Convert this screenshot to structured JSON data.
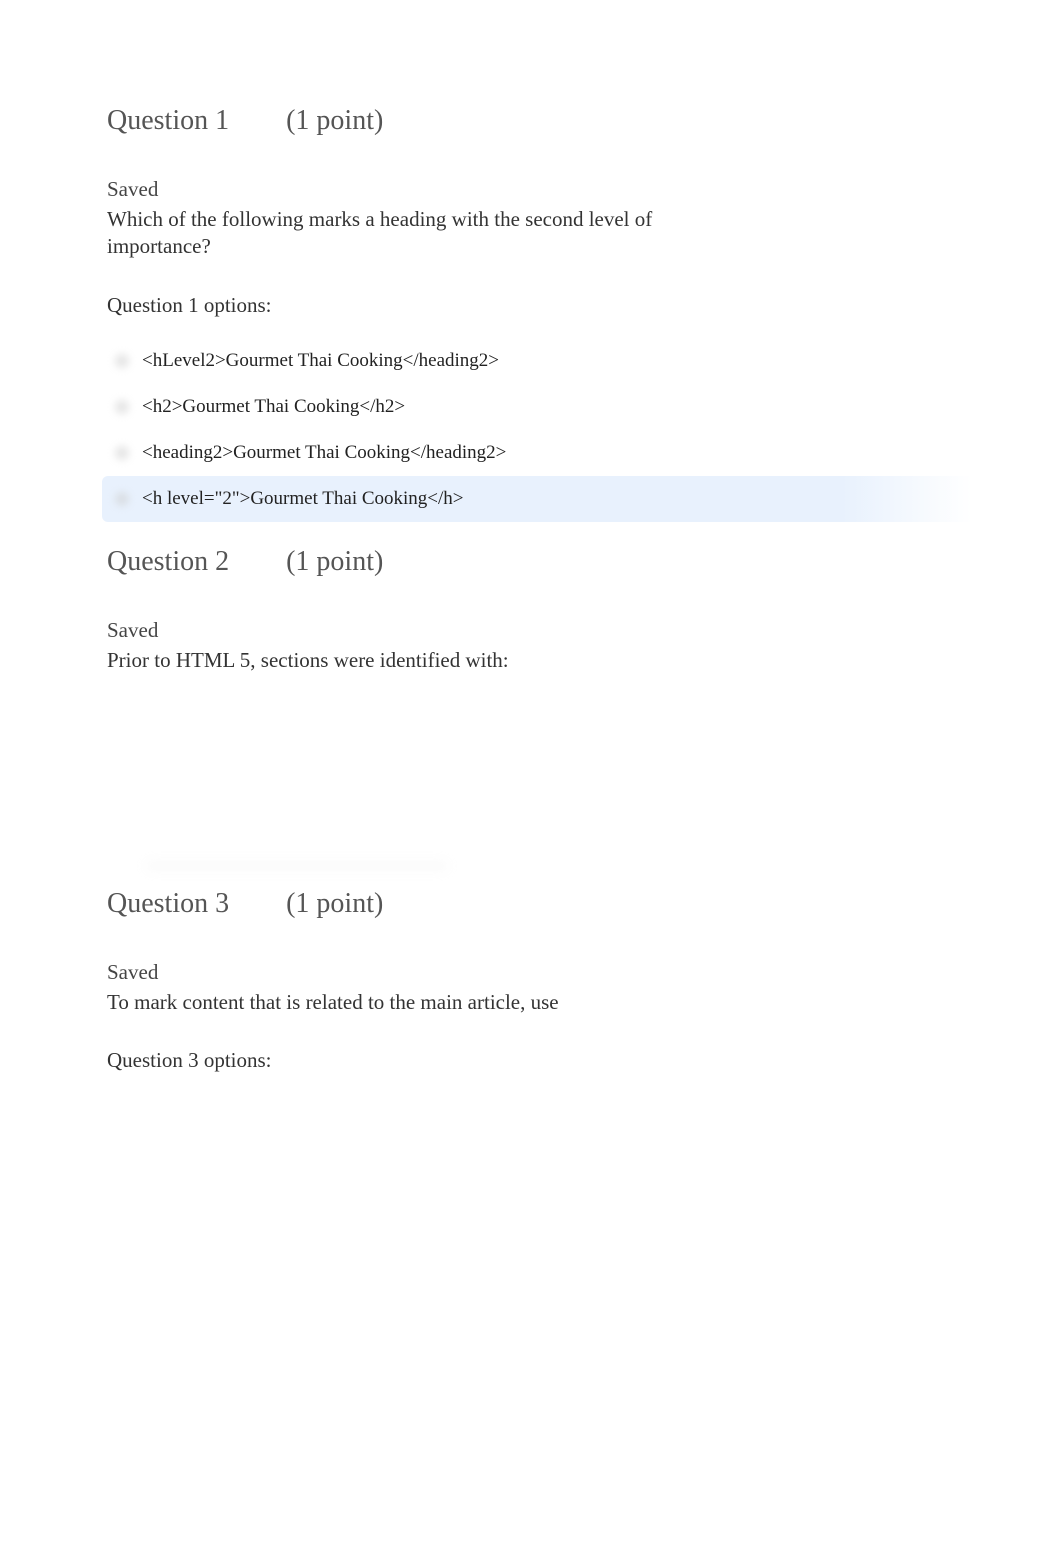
{
  "questions": [
    {
      "title_prefix": "Question 1",
      "points_text": "(1 point)",
      "saved_label": "Saved",
      "prompt": "Which of the following marks a heading with the second level of importance?",
      "options_label": "Question 1 options:",
      "options": [
        {
          "text": "<hLevel2>Gourmet Thai Cooking</heading2>",
          "selected": false
        },
        {
          "text": "<h2>Gourmet Thai Cooking</h2>",
          "selected": false
        },
        {
          "text": "<heading2>Gourmet Thai Cooking</heading2>",
          "selected": false
        },
        {
          "text": "<h level=\"2\">Gourmet Thai Cooking</h>",
          "selected": true
        }
      ]
    },
    {
      "title_prefix": "Question 2",
      "points_text": "(1 point)",
      "saved_label": "Saved",
      "prompt": "Prior to HTML 5, sections were identified with:",
      "options_label": "",
      "options": []
    },
    {
      "title_prefix": "Question 3",
      "points_text": "(1 point)",
      "saved_label": "Saved",
      "prompt": "To mark content that is related to the main article, use",
      "options_label": "Question 3 options:",
      "options": []
    }
  ]
}
